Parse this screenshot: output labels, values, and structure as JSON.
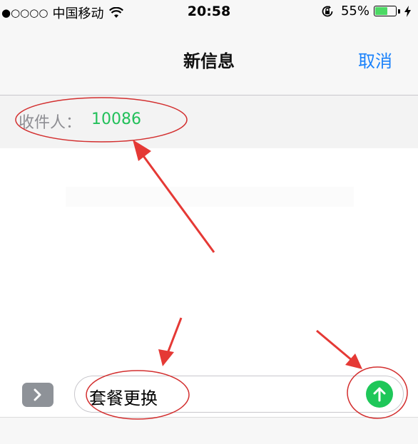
{
  "status_bar": {
    "signal": "●○○○○",
    "carrier": "中国移动",
    "time": "20:58",
    "battery_percent": "55%",
    "battery_level": 0.55,
    "icons": [
      "wifi-icon",
      "rotation-lock-icon",
      "battery-icon",
      "charging-bolt-icon"
    ]
  },
  "nav": {
    "title": "新信息",
    "cancel_label": "取消"
  },
  "recipient": {
    "label": "收件人：",
    "value": "10086"
  },
  "composer": {
    "message_text": "套餐更换",
    "expand_icon": "chevron-right-icon",
    "send_icon": "arrow-up-icon"
  },
  "colors": {
    "accent_blue": "#1a82fb",
    "recipient_green": "#22c05a",
    "send_green": "#1ec759",
    "annotation_red": "#e53935"
  }
}
